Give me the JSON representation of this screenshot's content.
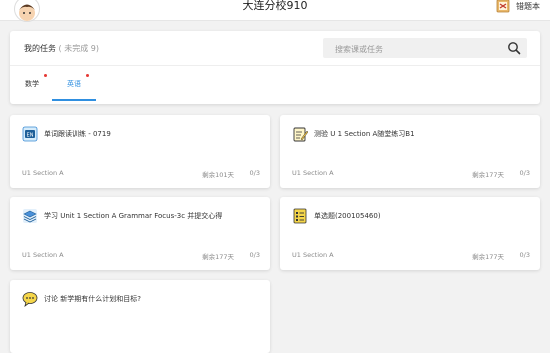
{
  "header": {
    "title": "大连分校910",
    "mistakes_label": "错题本"
  },
  "tasks_panel": {
    "title": "我的任务",
    "subtitle": "( 未完成 9)",
    "search_placeholder": "搜索课或任务"
  },
  "tabs": [
    {
      "label": "数学",
      "active": false,
      "has_dot": true
    },
    {
      "label": "英语",
      "active": true,
      "has_dot": true
    }
  ],
  "cards": [
    {
      "icon": "en-exercise-icon",
      "title": "单词跟读训练 - 0719",
      "section": "U1 Section A",
      "remaining": "剩余101天",
      "progress": "0/3"
    },
    {
      "icon": "test-edit-icon",
      "title": "测验 U 1 Section A随堂练习B1",
      "section": "U1 Section A",
      "remaining": "剩余177天",
      "progress": "0/3"
    },
    {
      "icon": "layers-icon",
      "title": "学习 Unit 1 Section A Grammar Focus-3c 并提交心得",
      "section": "U1 Section A",
      "remaining": "剩余177天",
      "progress": "0/3"
    },
    {
      "icon": "list-doc-icon",
      "title": "单选题(200105460)",
      "section": "U1 Section A",
      "remaining": "剩余177天",
      "progress": "0/3"
    },
    {
      "icon": "chat-icon",
      "title": "讨论 新学期有什么计划和目标?",
      "section": "",
      "remaining": "",
      "progress": ""
    }
  ],
  "colors": {
    "accent": "#2f8fe0",
    "dot": "#e53935",
    "background": "#f2f2f2"
  }
}
